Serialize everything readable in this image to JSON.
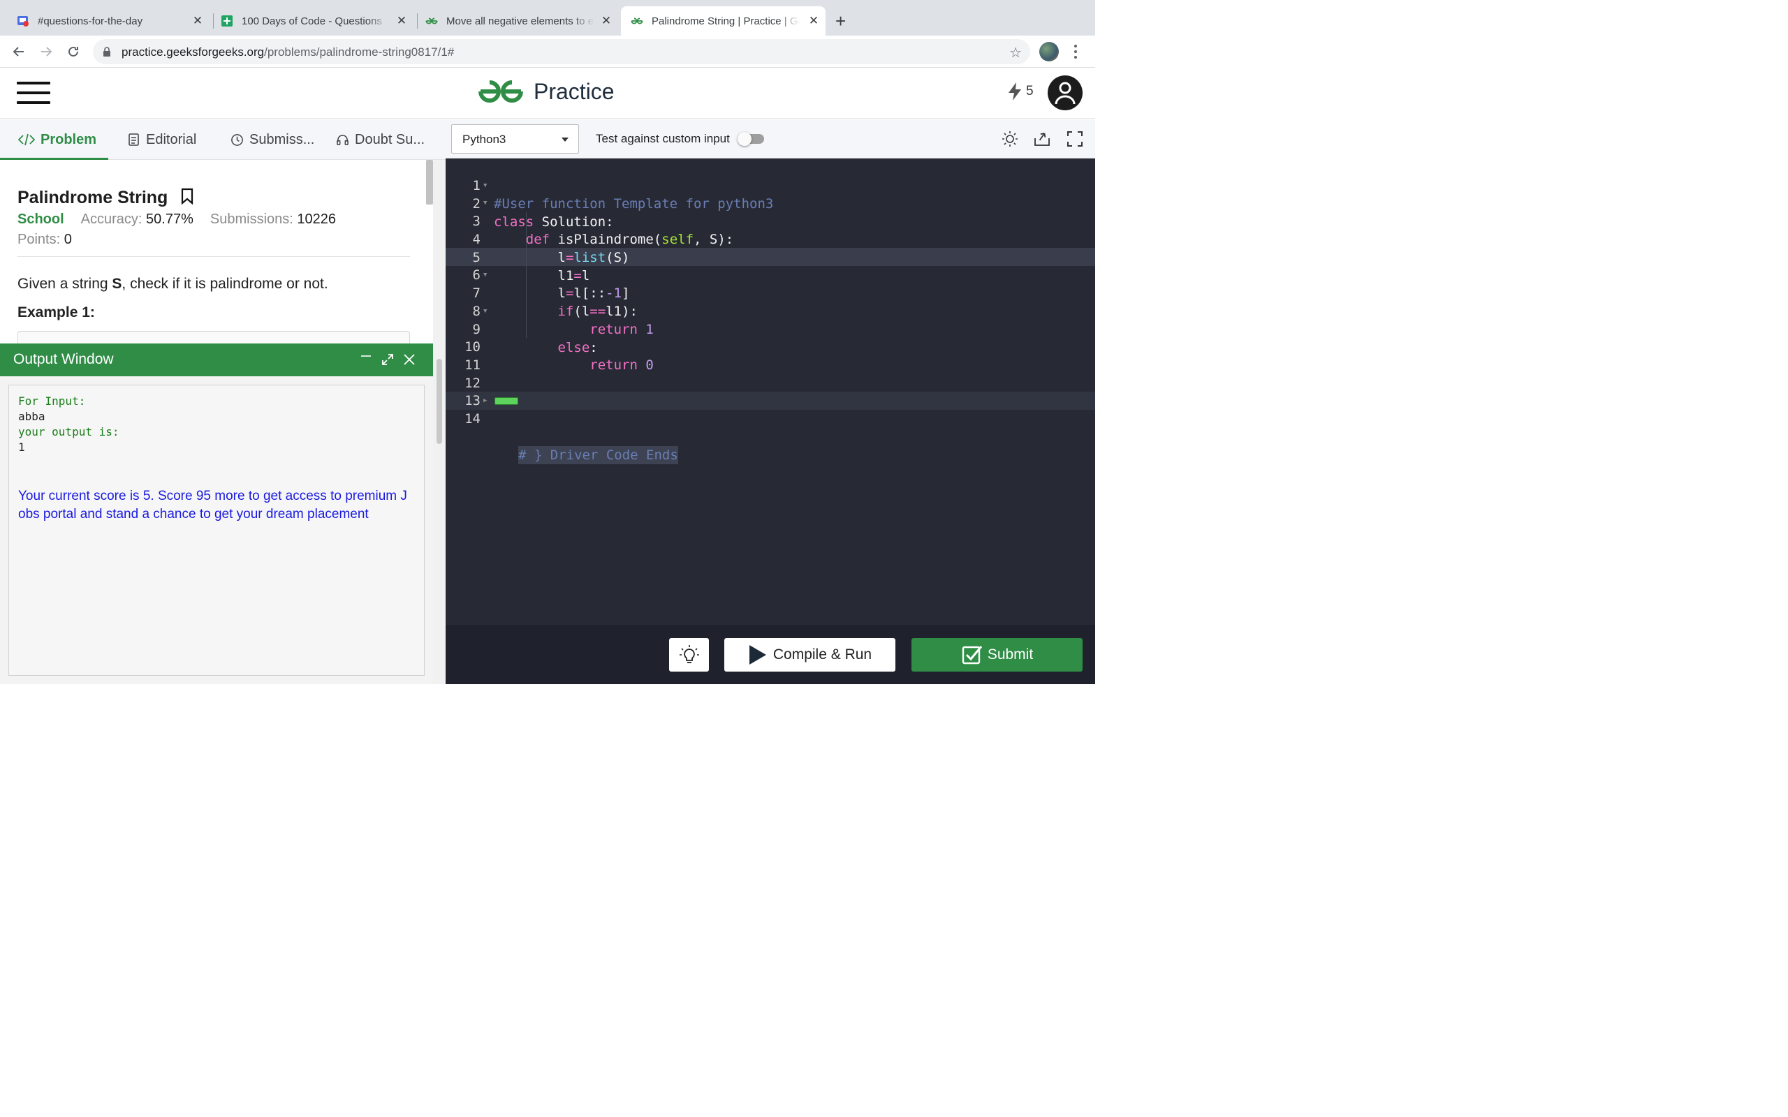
{
  "browser": {
    "tabs": [
      {
        "title": "#questions-for-the-day",
        "icon": "chat-app-icon"
      },
      {
        "title": "100 Days of Code - Questions",
        "icon": "sheets-icon"
      },
      {
        "title": "Move all negative elements to end",
        "icon": "gfg-icon"
      },
      {
        "title": "Palindrome String | Practice | GeeksforGeeks",
        "icon": "gfg-icon",
        "active": true
      }
    ],
    "url_host": "practice.geeksforgeeks.org",
    "url_path": "/problems/palindrome-string0817/1#"
  },
  "header": {
    "brand": "Practice",
    "streak_count": "5",
    "brand_color": "#2f8d46"
  },
  "problem_tabs": [
    "Problem",
    "Editorial",
    "Submiss...",
    "Doubt Su..."
  ],
  "problem": {
    "title": "Palindrome String",
    "difficulty": "School",
    "accuracy_label": "Accuracy:",
    "accuracy": "50.77%",
    "submissions_label": "Submissions:",
    "submissions": "10226",
    "points_label": "Points:",
    "points": "0",
    "statement_pre": "Given a string ",
    "statement_bold": "S",
    "statement_post": ", check if it is palindrome or not.",
    "example_heading": "Example 1:"
  },
  "output": {
    "title": "Output Window",
    "label_input": "For Input:",
    "input_value": "abba",
    "label_output": "your output is:",
    "output_value": "1",
    "score_message": "Your current score is 5. Score 95 more to get access to premium Jobs portal and stand a chance to get your dream placement"
  },
  "editor": {
    "language": "Python3",
    "custom_input_label": "Test against custom input",
    "custom_input_enabled": false,
    "line_numbers": [
      "1",
      "2",
      "3",
      "4",
      "5",
      "6",
      "7",
      "8",
      "9",
      "10",
      "11",
      "12",
      "13",
      "14"
    ],
    "folded_comment": "# } Driver Code Ends"
  },
  "footer": {
    "compile_label": "Compile & Run",
    "submit_label": "Submit"
  }
}
